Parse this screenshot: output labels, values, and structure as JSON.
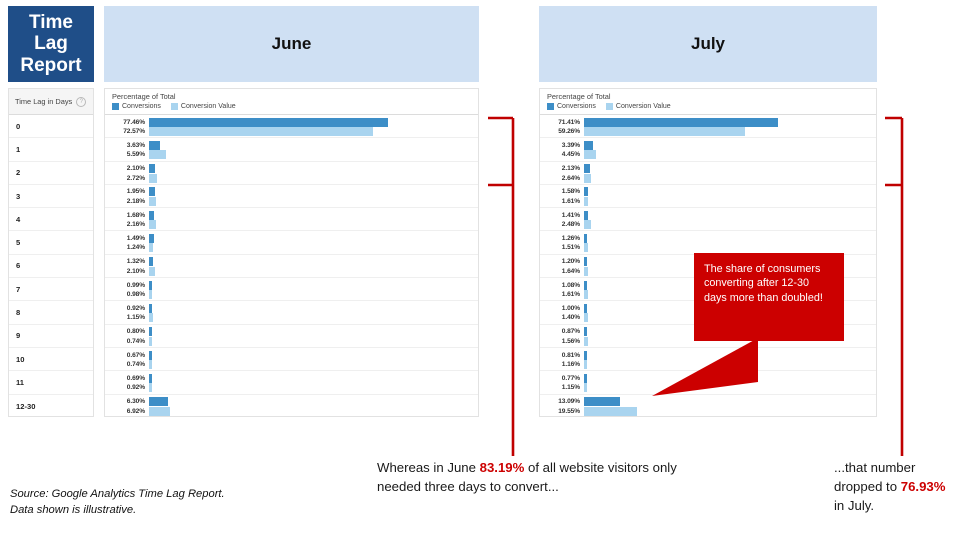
{
  "title_block": {
    "line1": "Time",
    "line2": "Lag",
    "line3": "Report"
  },
  "headers": {
    "june": "June",
    "july": "July"
  },
  "label_column": {
    "header": "Time Lag in Days",
    "help_icon": "help-circle-icon",
    "rows": [
      "0",
      "1",
      "2",
      "3",
      "4",
      "5",
      "6",
      "7",
      "8",
      "9",
      "10",
      "11",
      "12-30"
    ]
  },
  "panel": {
    "axis_title": "Percentage of Total",
    "legend": [
      {
        "label": "Conversions",
        "color": "#3d8ec7",
        "icon": "legend-swatch-conversions"
      },
      {
        "label": "Conversion Value",
        "color": "#a9d4ef",
        "icon": "legend-swatch-conversion-value"
      }
    ]
  },
  "callout": {
    "text": "The share of consumers converting after 12-30 days more than doubled!",
    "color": "#cc0000"
  },
  "captions": {
    "june": {
      "pre": "Whereas in June ",
      "highlight": "83.19%",
      "post": " of all website visitors only needed three days to convert..."
    },
    "july": {
      "pre": "...that number dropped to ",
      "highlight": "76.93%",
      "post": " in July."
    }
  },
  "source_note": "Source: Google Analytics Time Lag Report. Data shown is illustrative.",
  "chart_data": [
    {
      "type": "bar",
      "title": "June",
      "subtitle": "Percentage of Total",
      "xlabel": "Percentage of Total",
      "ylabel": "Time Lag in Days",
      "orientation": "horizontal",
      "grid": false,
      "legend_position": "top-left",
      "xlim": [
        0,
        100
      ],
      "categories": [
        "0",
        "1",
        "2",
        "3",
        "4",
        "5",
        "6",
        "7",
        "8",
        "9",
        "10",
        "11",
        "12-30"
      ],
      "series": [
        {
          "name": "Conversions",
          "color": "#3d8ec7",
          "values": [
            77.46,
            3.63,
            2.1,
            1.95,
            1.68,
            1.49,
            1.32,
            0.99,
            0.92,
            0.8,
            0.67,
            0.69,
            6.3
          ],
          "labels": [
            "77.46%",
            "3.63%",
            "2.10%",
            "1.95%",
            "1.68%",
            "1.49%",
            "1.32%",
            "0.99%",
            "0.92%",
            "0.80%",
            "0.67%",
            "0.69%",
            "6.30%"
          ]
        },
        {
          "name": "Conversion Value",
          "color": "#a9d4ef",
          "values": [
            72.57,
            5.59,
            2.72,
            2.18,
            2.16,
            1.24,
            2.1,
            0.98,
            1.15,
            0.74,
            0.74,
            0.92,
            6.92
          ],
          "labels": [
            "72.57%",
            "5.59%",
            "2.72%",
            "2.18%",
            "2.16%",
            "1.24%",
            "2.10%",
            "0.98%",
            "1.15%",
            "0.74%",
            "0.74%",
            "0.92%",
            "6.92%"
          ]
        }
      ]
    },
    {
      "type": "bar",
      "title": "July",
      "subtitle": "Percentage of Total",
      "xlabel": "Percentage of Total",
      "ylabel": "Time Lag in Days",
      "orientation": "horizontal",
      "grid": false,
      "legend_position": "top-left",
      "xlim": [
        0,
        100
      ],
      "categories": [
        "0",
        "1",
        "2",
        "3",
        "4",
        "5",
        "6",
        "7",
        "8",
        "9",
        "10",
        "11",
        "12-30"
      ],
      "series": [
        {
          "name": "Conversions",
          "color": "#3d8ec7",
          "values": [
            71.41,
            3.39,
            2.13,
            1.58,
            1.41,
            1.26,
            1.2,
            1.08,
            1.0,
            0.87,
            0.81,
            0.77,
            13.09
          ],
          "labels": [
            "71.41%",
            "3.39%",
            "2.13%",
            "1.58%",
            "1.41%",
            "1.26%",
            "1.20%",
            "1.08%",
            "1.00%",
            "0.87%",
            "0.81%",
            "0.77%",
            "13.09%"
          ]
        },
        {
          "name": "Conversion Value",
          "color": "#a9d4ef",
          "values": [
            59.26,
            4.45,
            2.64,
            1.61,
            2.48,
            1.51,
            1.64,
            1.61,
            1.4,
            1.56,
            1.16,
            1.15,
            19.55
          ],
          "labels": [
            "59.26%",
            "4.45%",
            "2.64%",
            "1.61%",
            "2.48%",
            "1.51%",
            "1.64%",
            "1.61%",
            "1.40%",
            "1.56%",
            "1.16%",
            "1.15%",
            "19.55%"
          ]
        }
      ]
    }
  ]
}
